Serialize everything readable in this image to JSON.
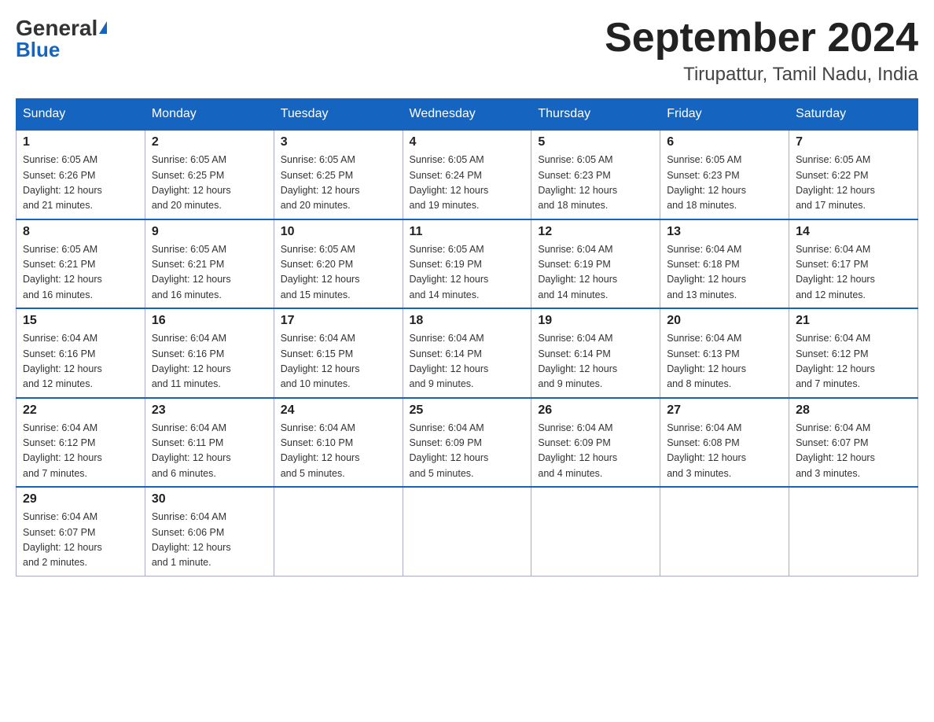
{
  "header": {
    "logo_general": "General",
    "logo_blue": "Blue",
    "month_title": "September 2024",
    "location": "Tirupattur, Tamil Nadu, India"
  },
  "days_of_week": [
    "Sunday",
    "Monday",
    "Tuesday",
    "Wednesday",
    "Thursday",
    "Friday",
    "Saturday"
  ],
  "weeks": [
    [
      {
        "day": "1",
        "sunrise": "6:05 AM",
        "sunset": "6:26 PM",
        "daylight": "12 hours and 21 minutes."
      },
      {
        "day": "2",
        "sunrise": "6:05 AM",
        "sunset": "6:25 PM",
        "daylight": "12 hours and 20 minutes."
      },
      {
        "day": "3",
        "sunrise": "6:05 AM",
        "sunset": "6:25 PM",
        "daylight": "12 hours and 20 minutes."
      },
      {
        "day": "4",
        "sunrise": "6:05 AM",
        "sunset": "6:24 PM",
        "daylight": "12 hours and 19 minutes."
      },
      {
        "day": "5",
        "sunrise": "6:05 AM",
        "sunset": "6:23 PM",
        "daylight": "12 hours and 18 minutes."
      },
      {
        "day": "6",
        "sunrise": "6:05 AM",
        "sunset": "6:23 PM",
        "daylight": "12 hours and 18 minutes."
      },
      {
        "day": "7",
        "sunrise": "6:05 AM",
        "sunset": "6:22 PM",
        "daylight": "12 hours and 17 minutes."
      }
    ],
    [
      {
        "day": "8",
        "sunrise": "6:05 AM",
        "sunset": "6:21 PM",
        "daylight": "12 hours and 16 minutes."
      },
      {
        "day": "9",
        "sunrise": "6:05 AM",
        "sunset": "6:21 PM",
        "daylight": "12 hours and 16 minutes."
      },
      {
        "day": "10",
        "sunrise": "6:05 AM",
        "sunset": "6:20 PM",
        "daylight": "12 hours and 15 minutes."
      },
      {
        "day": "11",
        "sunrise": "6:05 AM",
        "sunset": "6:19 PM",
        "daylight": "12 hours and 14 minutes."
      },
      {
        "day": "12",
        "sunrise": "6:04 AM",
        "sunset": "6:19 PM",
        "daylight": "12 hours and 14 minutes."
      },
      {
        "day": "13",
        "sunrise": "6:04 AM",
        "sunset": "6:18 PM",
        "daylight": "12 hours and 13 minutes."
      },
      {
        "day": "14",
        "sunrise": "6:04 AM",
        "sunset": "6:17 PM",
        "daylight": "12 hours and 12 minutes."
      }
    ],
    [
      {
        "day": "15",
        "sunrise": "6:04 AM",
        "sunset": "6:16 PM",
        "daylight": "12 hours and 12 minutes."
      },
      {
        "day": "16",
        "sunrise": "6:04 AM",
        "sunset": "6:16 PM",
        "daylight": "12 hours and 11 minutes."
      },
      {
        "day": "17",
        "sunrise": "6:04 AM",
        "sunset": "6:15 PM",
        "daylight": "12 hours and 10 minutes."
      },
      {
        "day": "18",
        "sunrise": "6:04 AM",
        "sunset": "6:14 PM",
        "daylight": "12 hours and 9 minutes."
      },
      {
        "day": "19",
        "sunrise": "6:04 AM",
        "sunset": "6:14 PM",
        "daylight": "12 hours and 9 minutes."
      },
      {
        "day": "20",
        "sunrise": "6:04 AM",
        "sunset": "6:13 PM",
        "daylight": "12 hours and 8 minutes."
      },
      {
        "day": "21",
        "sunrise": "6:04 AM",
        "sunset": "6:12 PM",
        "daylight": "12 hours and 7 minutes."
      }
    ],
    [
      {
        "day": "22",
        "sunrise": "6:04 AM",
        "sunset": "6:12 PM",
        "daylight": "12 hours and 7 minutes."
      },
      {
        "day": "23",
        "sunrise": "6:04 AM",
        "sunset": "6:11 PM",
        "daylight": "12 hours and 6 minutes."
      },
      {
        "day": "24",
        "sunrise": "6:04 AM",
        "sunset": "6:10 PM",
        "daylight": "12 hours and 5 minutes."
      },
      {
        "day": "25",
        "sunrise": "6:04 AM",
        "sunset": "6:09 PM",
        "daylight": "12 hours and 5 minutes."
      },
      {
        "day": "26",
        "sunrise": "6:04 AM",
        "sunset": "6:09 PM",
        "daylight": "12 hours and 4 minutes."
      },
      {
        "day": "27",
        "sunrise": "6:04 AM",
        "sunset": "6:08 PM",
        "daylight": "12 hours and 3 minutes."
      },
      {
        "day": "28",
        "sunrise": "6:04 AM",
        "sunset": "6:07 PM",
        "daylight": "12 hours and 3 minutes."
      }
    ],
    [
      {
        "day": "29",
        "sunrise": "6:04 AM",
        "sunset": "6:07 PM",
        "daylight": "12 hours and 2 minutes."
      },
      {
        "day": "30",
        "sunrise": "6:04 AM",
        "sunset": "6:06 PM",
        "daylight": "12 hours and 1 minute."
      },
      null,
      null,
      null,
      null,
      null
    ]
  ],
  "labels": {
    "sunrise": "Sunrise:",
    "sunset": "Sunset:",
    "daylight": "Daylight:"
  }
}
